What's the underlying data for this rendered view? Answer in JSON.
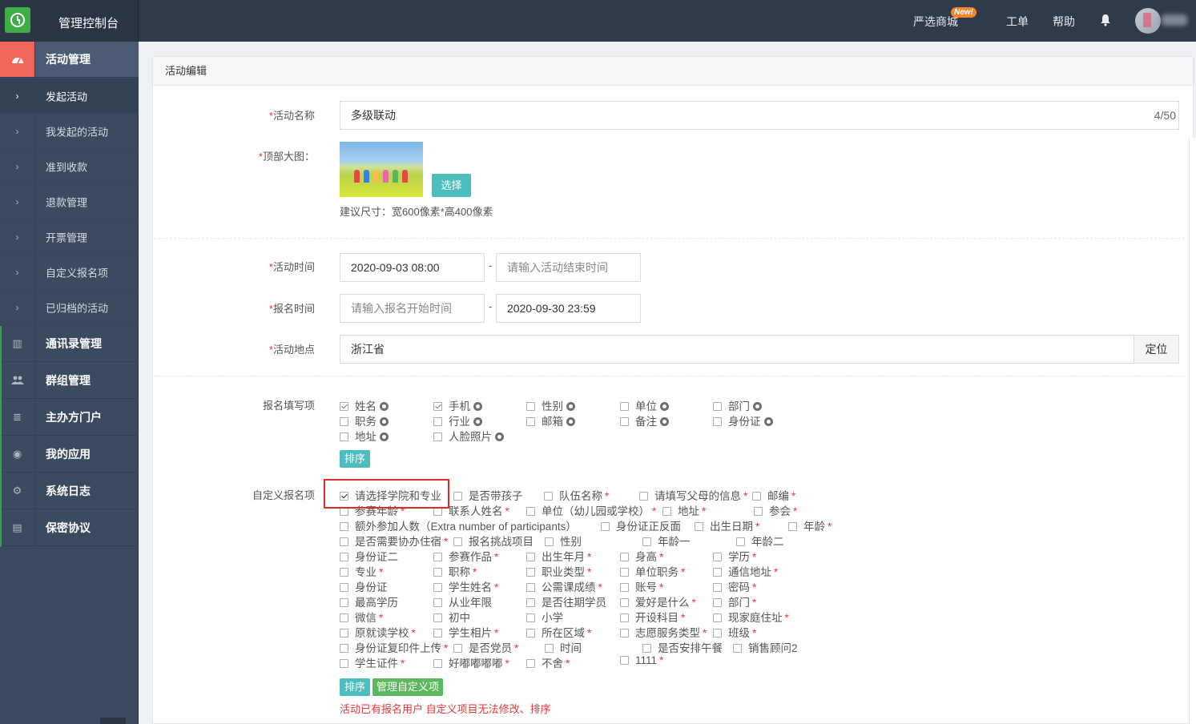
{
  "header": {
    "title": "管理控制台",
    "links": {
      "mall": "严选商城",
      "new_badge": "New!",
      "ticket": "工单",
      "help": "帮助"
    },
    "icons": [
      "bell-icon",
      "avatar"
    ]
  },
  "sidebar": {
    "activity": {
      "label": "活动管理",
      "icon": "dashboard-icon"
    },
    "sub_items": [
      {
        "label": "发起活动"
      },
      {
        "label": "我发起的活动"
      },
      {
        "label": "准到收款"
      },
      {
        "label": "退款管理"
      },
      {
        "label": "开票管理"
      },
      {
        "label": "自定义报名项"
      },
      {
        "label": "已归档的活动"
      }
    ],
    "groups": [
      {
        "label": "通讯录管理",
        "icon": "book-icon",
        "glyph": "▥"
      },
      {
        "label": "群组管理",
        "icon": "users-icon",
        "glyph": "👥"
      },
      {
        "label": "主办方门户",
        "icon": "list-icon",
        "glyph": "≣"
      },
      {
        "label": "我的应用",
        "icon": "app-icon",
        "glyph": "◉"
      },
      {
        "label": "系统日志",
        "icon": "cogs-icon",
        "glyph": "⚙"
      },
      {
        "label": "保密协议",
        "icon": "document-icon",
        "glyph": "▤"
      }
    ]
  },
  "panel": {
    "title": "活动编辑",
    "name_field": {
      "label": "活动名称",
      "value": "多级联动",
      "counter": "4/50"
    },
    "banner": {
      "label": "顶部大图：",
      "select_button": "选择",
      "hint": "建议尺寸：宽600像素*高400像素"
    },
    "time_field": {
      "label": "活动时间",
      "start": "2020-09-03 08:00",
      "dash": "-",
      "end_placeholder": "请输入活动结束时间"
    },
    "signup_time": {
      "label": "报名时间",
      "start_placeholder": "请输入报名开始时间",
      "dash": "-",
      "end": "2020-09-30 23:59"
    },
    "location": {
      "label": "活动地点",
      "value": "浙江省",
      "button": "定位"
    },
    "fill_items": {
      "label": "报名填写项",
      "options": [
        {
          "label": "姓名",
          "checked": true
        },
        {
          "label": "手机",
          "checked": true
        },
        {
          "label": "性别",
          "checked": false
        },
        {
          "label": "单位",
          "checked": false
        },
        {
          "label": "部门",
          "checked": false
        },
        {
          "label": "职务",
          "checked": false
        },
        {
          "label": "行业",
          "checked": false
        },
        {
          "label": "邮箱",
          "checked": false
        },
        {
          "label": "备注",
          "checked": false
        },
        {
          "label": "身份证",
          "checked": false
        },
        {
          "label": "地址",
          "checked": false
        },
        {
          "label": "人脸照片",
          "checked": false
        }
      ],
      "sort_button": "排序"
    },
    "custom_items": {
      "label": "自定义报名项",
      "options": [
        {
          "label": "请选择学院和专业",
          "checked": true,
          "req": false
        },
        {
          "label": "是否带孩子",
          "req": false
        },
        {
          "label": "队伍名称",
          "req": true
        },
        {
          "label": "请填写父母的信息",
          "req": true
        },
        {
          "label": "邮编",
          "req": true
        },
        {
          "label": "参赛年龄",
          "req": true
        },
        {
          "label": "联系人姓名",
          "req": true
        },
        {
          "label": "单位（幼儿园或学校）",
          "req": true
        },
        {
          "label": "地址",
          "req": true
        },
        {
          "label": "参会",
          "req": true
        },
        {
          "label": "额外参加人数（Extra number of participants）",
          "req": false
        },
        {
          "label": "身份证正反面",
          "req": false
        },
        {
          "label": "出生日期",
          "req": true
        },
        {
          "label": "年龄",
          "req": true
        },
        {
          "label": "是否需要协办住宿",
          "req": true
        },
        {
          "label": "报名挑战项目",
          "req": false
        },
        {
          "label": "性别",
          "req": false
        },
        {
          "label": "年龄一",
          "req": false
        },
        {
          "label": "年龄二",
          "req": false
        },
        {
          "label": "身份证二",
          "req": false
        },
        {
          "label": "参赛作品",
          "req": true
        },
        {
          "label": "出生年月",
          "req": true
        },
        {
          "label": "身高",
          "req": true
        },
        {
          "label": "学历",
          "req": true
        },
        {
          "label": "专业",
          "req": true
        },
        {
          "label": "职称",
          "req": true
        },
        {
          "label": "职业类型",
          "req": true
        },
        {
          "label": "单位职务",
          "req": true
        },
        {
          "label": "通信地址",
          "req": true
        },
        {
          "label": "身份证",
          "req": false
        },
        {
          "label": "学生姓名",
          "req": true
        },
        {
          "label": "公需课成绩",
          "req": true
        },
        {
          "label": "账号",
          "req": true
        },
        {
          "label": "密码",
          "req": true
        },
        {
          "label": "最高学历",
          "req": false
        },
        {
          "label": "从业年限",
          "req": false
        },
        {
          "label": "是否往期学员",
          "req": false
        },
        {
          "label": "爱好是什么",
          "req": true
        },
        {
          "label": "部门",
          "req": true
        },
        {
          "label": "微信",
          "req": true
        },
        {
          "label": "初中",
          "req": false
        },
        {
          "label": "小学",
          "req": false
        },
        {
          "label": "开设科目",
          "req": true
        },
        {
          "label": "现家庭住址",
          "req": true
        },
        {
          "label": "原就读学校",
          "req": true
        },
        {
          "label": "学生相片",
          "req": true
        },
        {
          "label": "所在区域",
          "req": true
        },
        {
          "label": "志愿服务类型",
          "req": true
        },
        {
          "label": "班级",
          "req": true
        },
        {
          "label": "身份证复印件上传",
          "req": true
        },
        {
          "label": "是否党员",
          "req": true
        },
        {
          "label": "时间",
          "req": false
        },
        {
          "label": "是否安排午餐",
          "req": false
        },
        {
          "label": "销售顾问2",
          "req": false
        },
        {
          "label": "学生证件",
          "req": true
        },
        {
          "label": "好嘟嘟嘟嘟",
          "req": true
        },
        {
          "label": "不舍",
          "req": true
        },
        {
          "label": "1111",
          "req": true
        }
      ],
      "sort_button": "排序",
      "manage_button": "管理自定义项",
      "warning": "活动已有报名用户 自定义项目无法修改、排序"
    },
    "star": "*"
  }
}
